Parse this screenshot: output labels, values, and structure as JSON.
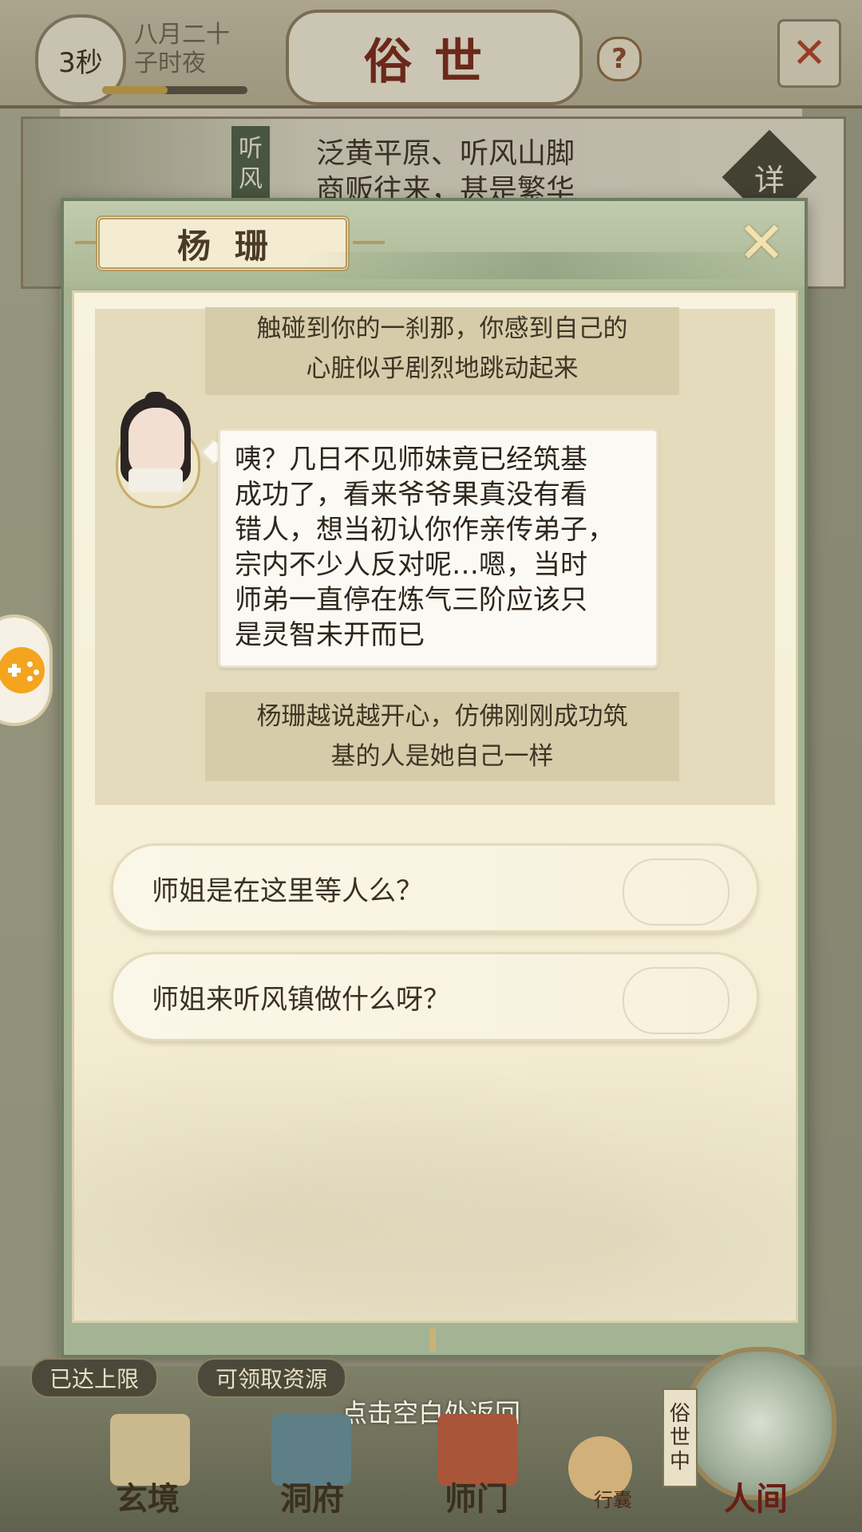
{
  "topbar": {
    "timer": "3秒",
    "date_line1": "八月二十",
    "date_line2": "子时夜",
    "progress": 0.45,
    "scene_title": "俗世",
    "help_icon": "question-mark-icon",
    "menu_icon": "crossed-swords-icon"
  },
  "location": {
    "tag": "听风",
    "desc_line1": "泛黄平原、听风山脚",
    "desc_line2": "商贩往来，甚是繁华",
    "detail_label": "详"
  },
  "dialog": {
    "speaker_name": "杨珊",
    "close_icon": "close-x-icon",
    "narration_1_line1": "触碰到你的一刹那，你感到自己的",
    "narration_1_line2": "心脏似乎剧烈地跳动起来",
    "speech_lines": [
      "咦？几日不见师妹竟已经筑基",
      "成功了，看来爷爷果真没有看",
      "错人，想当初认你作亲传弟子，",
      "宗内不少人反对呢…嗯，当时",
      "师弟一直停在炼气三阶应该只",
      "是灵智未开而已"
    ],
    "narration_2_line1": "杨珊越说越开心，仿佛刚刚成功筑",
    "narration_2_line2": "基的人是她自己一样",
    "choices": [
      "师姐是在这里等人么？",
      "师姐来听风镇做什么呀？"
    ]
  },
  "bottom": {
    "pill_left": "已达上限",
    "pill_right": "可领取资源",
    "return_hint": "点击空白处返回",
    "nav": [
      "玄境",
      "洞府",
      "师门",
      "行囊",
      "人间"
    ],
    "world_tag": [
      "俗",
      "世",
      "中"
    ],
    "side_button_icon": "gamepad-icon"
  }
}
